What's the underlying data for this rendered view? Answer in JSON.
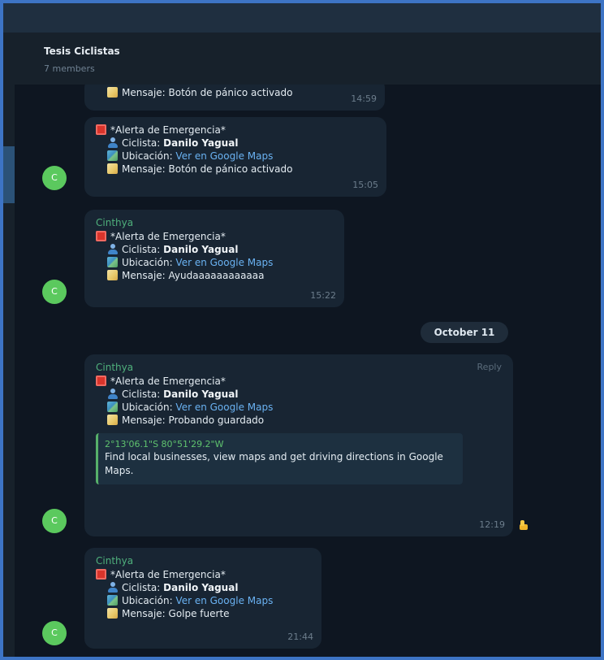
{
  "header": {
    "title": "Tesis Ciclistas",
    "subtitle": "7 members"
  },
  "date_divider": "October 11",
  "messages": [
    {
      "sender": "",
      "lines": {
        "msg": "Mensaje: Botón de pánico activado"
      },
      "time": "14:59"
    },
    {
      "sender": "",
      "avatar": "C",
      "lines": {
        "alert": "*Alerta de Emergencia*",
        "cyclist_label": "Ciclista: ",
        "cyclist_name": "Danilo Yagual",
        "location_label": "Ubicación: ",
        "location_link": "Ver en Google Maps",
        "msg": "Mensaje: Botón de pánico activado"
      },
      "time": "15:05"
    },
    {
      "sender": "Cinthya",
      "avatar": "C",
      "lines": {
        "alert": "*Alerta de Emergencia*",
        "cyclist_label": "Ciclista: ",
        "cyclist_name": "Danilo Yagual",
        "location_label": "Ubicación: ",
        "location_link": "Ver en Google Maps",
        "msg": "Mensaje: Ayudaaaaaaaaaaaa"
      },
      "time": "15:22"
    },
    {
      "sender": "Cinthya",
      "avatar": "C",
      "reply": "Reply",
      "lines": {
        "alert": "*Alerta de Emergencia*",
        "cyclist_label": "Ciclista: ",
        "cyclist_name": "Danilo Yagual",
        "location_label": "Ubicación: ",
        "location_link": "Ver en Google Maps",
        "msg": "Mensaje: Probando guardado"
      },
      "preview": {
        "title": "2°13'06.1\"S 80°51'29.2\"W",
        "description": "Find local businesses, view maps and get driving directions in Google Maps."
      },
      "time": "12:19"
    },
    {
      "sender": "Cinthya",
      "avatar": "C",
      "lines": {
        "alert": "*Alerta de Emergencia*",
        "cyclist_label": "Ciclista: ",
        "cyclist_name": "Danilo Yagual",
        "location_label": "Ubicación: ",
        "location_link": "Ver en Google Maps",
        "msg": "Mensaje: Golpe fuerte"
      },
      "time": "21:44"
    }
  ],
  "icons": {
    "alert": "red-siren-icon",
    "cyclist": "user-icon",
    "location": "map-icon",
    "message": "memo-icon",
    "reaction": "thumbs-up-icon"
  },
  "colors": {
    "background": "#0e1621",
    "bubble": "#182533",
    "sender": "#4fb07c",
    "link": "#6ab2f2",
    "avatar": "#5bc95e",
    "frame": "#3d74c5"
  }
}
